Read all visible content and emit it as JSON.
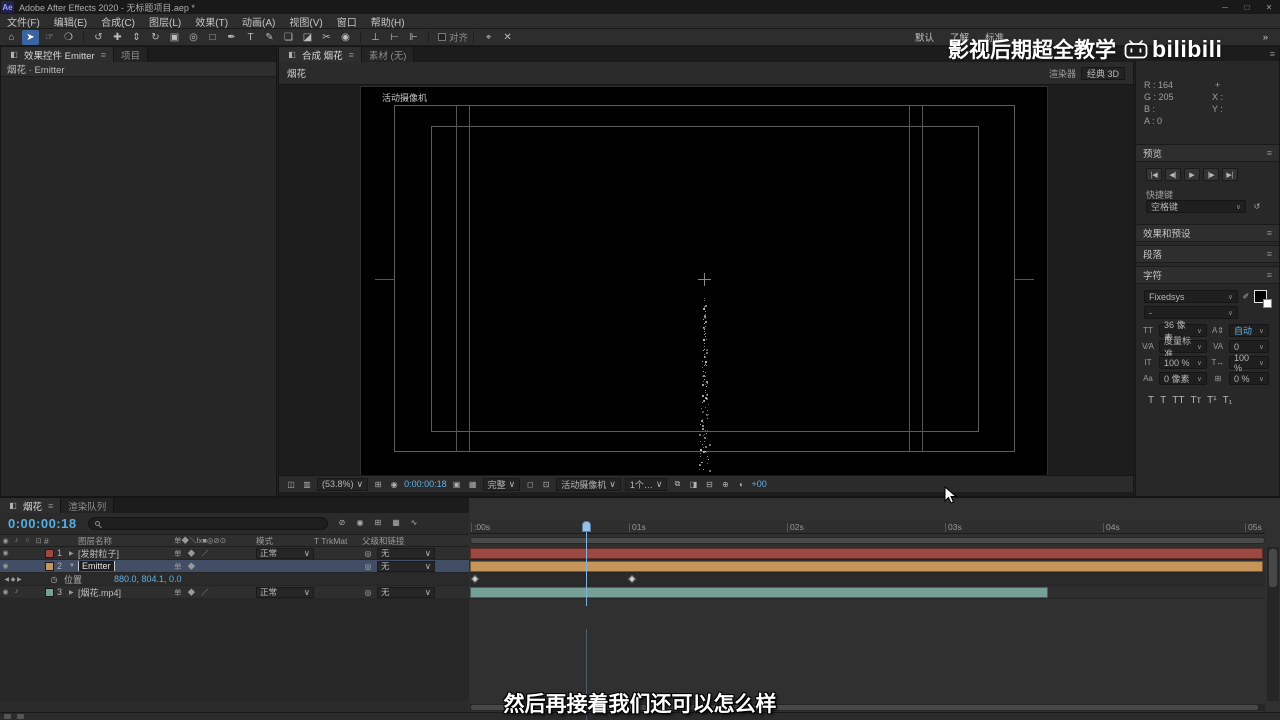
{
  "titlebar": {
    "badge": "Ae",
    "title": "Adobe After Effects 2020 - 无标题项目.aep *",
    "min": "─",
    "max": "□",
    "close": "✕"
  },
  "menubar": {
    "items": [
      "文件(F)",
      "编辑(E)",
      "合成(C)",
      "图层(L)",
      "效果(T)",
      "动画(A)",
      "视图(V)",
      "窗口",
      "帮助(H)"
    ]
  },
  "toolbar": {
    "tools": [
      {
        "name": "home",
        "glyph": "⌂"
      },
      {
        "name": "selection",
        "glyph": "➤"
      },
      {
        "name": "hand",
        "glyph": "☞"
      },
      {
        "name": "zoom",
        "glyph": "❍"
      },
      {
        "name": "orbit-camera",
        "glyph": "↺"
      },
      {
        "name": "pan-camera",
        "glyph": "✚"
      },
      {
        "name": "dolly-camera",
        "glyph": "⇕"
      },
      {
        "name": "rotation",
        "glyph": "↻"
      },
      {
        "name": "camera",
        "glyph": "▣"
      },
      {
        "name": "pan-behind",
        "glyph": "◎"
      },
      {
        "name": "shape",
        "glyph": "□"
      },
      {
        "name": "pen",
        "glyph": "✒"
      },
      {
        "name": "type",
        "glyph": "T"
      },
      {
        "name": "brush",
        "glyph": "✎"
      },
      {
        "name": "clone-stamp",
        "glyph": "❏"
      },
      {
        "name": "eraser",
        "glyph": "◪"
      },
      {
        "name": "roto-brush",
        "glyph": "✂"
      },
      {
        "name": "puppet-pin",
        "glyph": "◉"
      }
    ],
    "axis": [
      {
        "name": "axis-local",
        "glyph": "⊥"
      },
      {
        "name": "axis-world",
        "glyph": "⊢"
      },
      {
        "name": "axis-view",
        "glyph": "⊩"
      }
    ],
    "snap_label": "对齐",
    "mask_icons": [
      {
        "name": "target",
        "glyph": "⌖"
      },
      {
        "name": "clear",
        "glyph": "✕"
      }
    ],
    "workspaces": [
      "默认",
      "了解",
      "标准"
    ],
    "overflow": "»"
  },
  "fx_panel": {
    "tab_active": "效果控件 Emitter",
    "tab_inactive": "项目",
    "context_line": "烟花 · Emitter"
  },
  "comp_panel": {
    "tab_active": "合成 烟花",
    "tab_inactive": "素材 (无)",
    "comp_label": "烟花",
    "renderer_label": "渲染器",
    "renderer_value": "经典 3D",
    "viewer_camera_label": "活动摄像机",
    "statusbar": {
      "zoom": "(53.8%)",
      "time": "0:00:00:18",
      "resolution": "完整",
      "camera": "活动摄像机",
      "view_layout": "1个…",
      "exposure": "+00"
    }
  },
  "right_panel": {
    "info": {
      "r": "R :",
      "r_val": "164",
      "g": "G :",
      "g_val": "205",
      "b": "B :",
      "b_val": "",
      "a": "A :",
      "a_val": "0",
      "plus": "+",
      "x": "X :",
      "y": "Y :"
    },
    "preview": {
      "title": "预览",
      "buttons": [
        "|◀",
        "◀|",
        "▶",
        "|▶",
        "▶|"
      ]
    },
    "shortcut": {
      "label": "快捷键",
      "value": "空格键",
      "reset": "↺"
    },
    "effects_presets_title": "效果和预设",
    "paragraph_title": "段落",
    "character": {
      "title": "字符",
      "font_family": "Fixedsys",
      "font_style": "-",
      "size_icon": "TT",
      "font_size": "36 像素",
      "leading_icon": "A⇕",
      "leading": "自动",
      "kerning_icon": "V⁄A",
      "kerning": "度量标准",
      "tracking_icon": "VA",
      "tracking": "0",
      "vscale_icon": "IT",
      "vertical_scale": "100 %",
      "hscale_icon": "T↔",
      "horizontal_scale": "100 %",
      "baseline_icon": "Aa",
      "baseline_shift": "0 像素",
      "propspace_icon": "⊞",
      "proportional_spacing": "0 %",
      "faux": [
        "T",
        "T",
        "TT",
        "Tᴛ",
        "T¹",
        "T₁"
      ]
    }
  },
  "timeline": {
    "tab_active": "烟花",
    "tab_inactive": "渲染队列",
    "time_display": "0:00:00:18",
    "header_icons": [
      "⊘",
      "◉",
      "⊞",
      "▦",
      "∿"
    ],
    "columns": {
      "layer_name": "图层名称",
      "switches": "单◆＼fx■◎⊘⊙",
      "mode": "模式",
      "trkmat": "T TrkMat",
      "parent": "父级和链接"
    },
    "ruler": [
      ":00s",
      "01s",
      "02s",
      "03s",
      "04s",
      "05s"
    ],
    "cti_fraction": 0.146,
    "keyframes": [
      0.002,
      0.2
    ],
    "layers": [
      {
        "num": "1",
        "name": "[发射粒子]",
        "switches": "单 ◆ ／",
        "mode": "正常",
        "parent": "无",
        "color": "#9c4a41",
        "bar": {
          "start": 0,
          "end": 0.998
        }
      },
      {
        "num": "2",
        "name": "Emitter",
        "switches": "单 ◆",
        "mode": "",
        "parent": "无",
        "color": "#c69559",
        "bar": {
          "start": 0,
          "end": 0.998
        },
        "property": {
          "nav": "◀ ◆ ▶",
          "stopwatch": "◷",
          "name": "位置",
          "value": "880.0, 804.1, 0.0"
        }
      },
      {
        "num": "3",
        "name": "[烟花.mp4]",
        "switches": "单 ◆ ／",
        "mode": "正常",
        "parent": "无",
        "color": "#76a096",
        "bar": {
          "start": 0,
          "end": 0.727
        }
      }
    ]
  },
  "overlays": {
    "watermark_text": "影视后期超全教学",
    "watermark_logo": "bilibili",
    "subtitle": "然后再接着我们还可以怎么样"
  }
}
